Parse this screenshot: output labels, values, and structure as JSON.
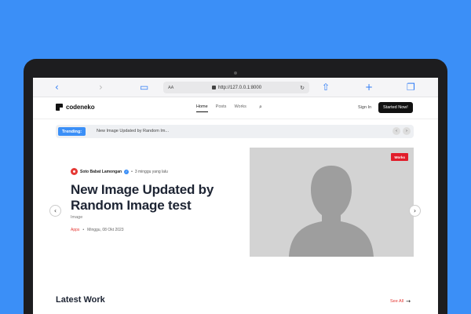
{
  "browser": {
    "address_prefix": "AA",
    "url": "http://127.0.0.1:8000"
  },
  "site": {
    "logo_text": "codeneko",
    "nav": [
      "Home",
      "Posts",
      "Works"
    ],
    "signin_label": "Sign In",
    "cta_label": "Started Now!"
  },
  "trending": {
    "label": "Trending:",
    "text": "New Image Updated by Random Im..."
  },
  "hero": {
    "author": "Soto Babat Lamongan",
    "time_ago": "3 minggu yang lalu",
    "title": "New Image Updated by Random Image test",
    "subtitle": "Image",
    "category": "Apps",
    "date": "Minggu, 08 Okt 2023",
    "badge": "Works"
  },
  "latest": {
    "heading": "Latest Work",
    "see_all": "See All"
  },
  "colors": {
    "background": "#3b8ff7",
    "accent_red": "#e53935",
    "accent_blue": "#3b8ff7"
  }
}
